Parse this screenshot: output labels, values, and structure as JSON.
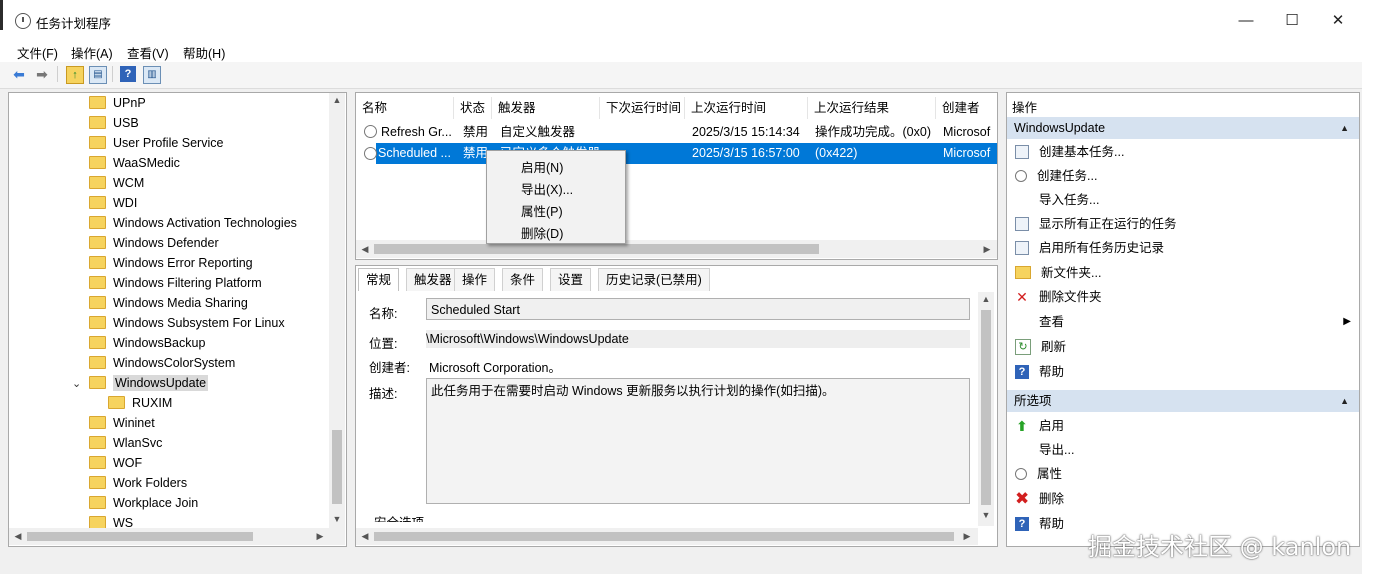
{
  "window": {
    "title": "任务计划程序",
    "controls": {
      "minimize": "—",
      "maximize": "☐",
      "close": "✕"
    }
  },
  "menu": [
    "文件(F)",
    "操作(A)",
    "查看(V)",
    "帮助(H)"
  ],
  "toolbar": {
    "icons": [
      "back-arrow-icon",
      "forward-arrow-icon",
      "up-folder-icon",
      "show-hide-tree-icon",
      "help-icon",
      "show-hide-action-pane-icon"
    ],
    "help_glyph": "?"
  },
  "tree": {
    "items": [
      {
        "label": "UPnP"
      },
      {
        "label": "USB"
      },
      {
        "label": "User Profile Service"
      },
      {
        "label": "WaaSMedic"
      },
      {
        "label": "WCM"
      },
      {
        "label": "WDI"
      },
      {
        "label": "Windows Activation Technologies"
      },
      {
        "label": "Windows Defender"
      },
      {
        "label": "Windows Error Reporting"
      },
      {
        "label": "Windows Filtering Platform"
      },
      {
        "label": "Windows Media Sharing"
      },
      {
        "label": "Windows Subsystem For Linux"
      },
      {
        "label": "WindowsBackup"
      },
      {
        "label": "WindowsColorSystem"
      },
      {
        "label": "WindowsUpdate",
        "selected": true,
        "expanded": true
      },
      {
        "label": "RUXIM",
        "child": true
      },
      {
        "label": "Wininet"
      },
      {
        "label": "WlanSvc"
      },
      {
        "label": "WOF"
      },
      {
        "label": "Work Folders"
      },
      {
        "label": "Workplace Join"
      },
      {
        "label": "WS"
      }
    ]
  },
  "tasklist": {
    "columns": [
      "名称",
      "状态",
      "触发器",
      "下次运行时间",
      "上次运行时间",
      "上次运行结果",
      "创建者"
    ],
    "rows": [
      {
        "name": "Refresh Gr...",
        "status": "禁用",
        "trigger": "自定义触发器",
        "next": "",
        "last": "2025/3/15 15:14:34",
        "result": "操作成功完成。(0x0)",
        "author": "Microsof"
      },
      {
        "name": "Scheduled ...",
        "status": "禁用",
        "trigger": "已定义多个触发器",
        "next": "",
        "last": "2025/3/15 16:57:00",
        "result": "(0x422)",
        "author": "Microsof",
        "selected": true
      }
    ]
  },
  "context_menu": [
    "启用(N)",
    "导出(X)...",
    "属性(P)",
    "删除(D)"
  ],
  "details": {
    "tabs": [
      "常规",
      "触发器",
      "操作",
      "条件",
      "设置",
      "历史记录(已禁用)"
    ],
    "active_tab": "常规",
    "name_label": "名称:",
    "name_value": "Scheduled Start",
    "location_label": "位置:",
    "location_value": "\\Microsoft\\Windows\\WindowsUpdate",
    "author_label": "创建者:",
    "author_value": "Microsoft Corporation。",
    "desc_label": "描述:",
    "desc_value": "此任务用于在需要时启动 Windows 更新服务以执行计划的操作(如扫描)。",
    "security_label": "安全选项"
  },
  "actions": {
    "title": "操作",
    "section1": "WindowsUpdate",
    "items1": [
      {
        "label": "创建基本任务...",
        "icon": "create-basic-task-icon"
      },
      {
        "label": "创建任务...",
        "icon": "create-task-icon"
      },
      {
        "label": "导入任务...",
        "icon": ""
      },
      {
        "label": "显示所有正在运行的任务",
        "icon": "running-tasks-icon"
      },
      {
        "label": "启用所有任务历史记录",
        "icon": "history-icon"
      },
      {
        "label": "新文件夹...",
        "icon": "new-folder-icon"
      },
      {
        "label": "删除文件夹",
        "icon": "delete-icon"
      },
      {
        "label": "查看",
        "icon": "",
        "submenu": true
      },
      {
        "label": "刷新",
        "icon": "refresh-icon"
      },
      {
        "label": "帮助",
        "icon": "help-icon"
      }
    ],
    "section2": "所选项",
    "items2": [
      {
        "label": "启用",
        "icon": "enable-arrow-icon"
      },
      {
        "label": "导出...",
        "icon": ""
      },
      {
        "label": "属性",
        "icon": "properties-icon"
      },
      {
        "label": "删除",
        "icon": "delete-icon"
      },
      {
        "label": "帮助",
        "icon": "help-icon"
      }
    ]
  },
  "watermark": "掘金技术社区 @ kanlon"
}
